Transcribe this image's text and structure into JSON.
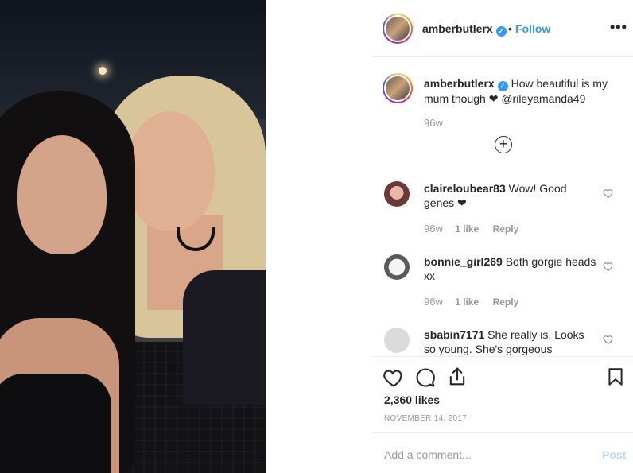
{
  "post": {
    "username": "amberbutlerx",
    "follow_label": "Follow",
    "dot": "•",
    "more": "•••",
    "verified_icon": "✓"
  },
  "caption": {
    "username": "amberbutlerx",
    "text": "How beautiful is my mum though ❤ @rileyamanda49",
    "time": "96w"
  },
  "comments": [
    {
      "username": "claireloubear83",
      "text": "Wow! Good genes ❤",
      "time": "96w",
      "likes": "1 like",
      "reply": "Reply"
    },
    {
      "username": "bonnie_girl269",
      "text": "Both gorgie heads xx",
      "time": "96w",
      "likes": "1 like",
      "reply": "Reply"
    },
    {
      "username": "sbabin7171",
      "text": "She really is. Looks so young. She's gorgeous",
      "time": "",
      "likes": "",
      "reply": ""
    }
  ],
  "actions": {
    "likes_total": "2,360 likes",
    "date": "NOVEMBER 14, 2017"
  },
  "add_comment": {
    "placeholder": "Add a comment...",
    "post_label": "Post"
  },
  "colors": {
    "accent": "#3897f0",
    "text": "#262626",
    "muted": "#999999",
    "border": "#efefef"
  }
}
